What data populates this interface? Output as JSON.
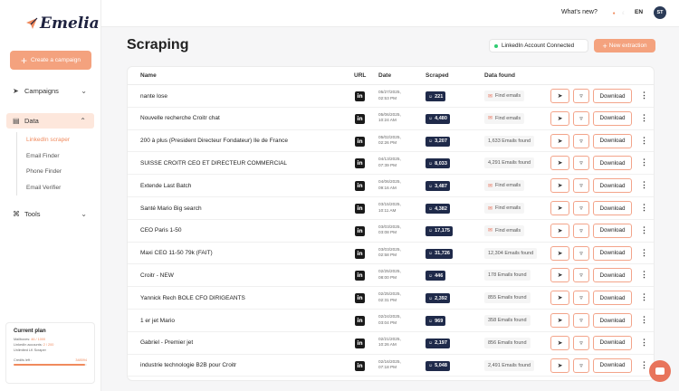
{
  "app": {
    "logo": "Emelia"
  },
  "sidebar": {
    "create_campaign": "Create a campaign",
    "campaigns": "Campaigns",
    "data": "Data",
    "data_sub": [
      "LinkedIn scraper",
      "Email Finder",
      "Phone Finder",
      "Email Verifier"
    ],
    "tools": "Tools",
    "plan": {
      "title": "Current plan",
      "mailboxes_label": "Mailboxes:",
      "mailboxes_value": "46 / 1000",
      "linkedin_label": "LinkedIn accounts:",
      "linkedin_value": "2 / 200",
      "scraper": "Unlimited LK Scraper",
      "credits_label": "Credits left :",
      "credits_value": "348594",
      "credits_fraction": 0.98
    }
  },
  "topbar": {
    "whats_new": "What's new?",
    "lang": "EN",
    "avatar": "ST"
  },
  "page": {
    "title": "Scraping",
    "linkedin_status": "LinkedIn Account Connected",
    "new_extraction": "New extraction"
  },
  "table": {
    "headers": {
      "name": "Name",
      "url": "URL",
      "date": "Date",
      "scraped": "Scraped",
      "found": "Data found"
    },
    "download_label": "Download",
    "find_emails_label": "Find emails",
    "rows": [
      {
        "name": "nante lose",
        "date1": "05/27/2025,",
        "date2": "02:53 PM",
        "scraped": "221",
        "found": "Find emails",
        "has_emails": false
      },
      {
        "name": "Nouvelle recherche Croitr chat",
        "date1": "05/06/2025,",
        "date2": "10:24 AM",
        "scraped": "4,480",
        "found": "Find emails",
        "has_emails": false
      },
      {
        "name": "200 à plus (President Directeur Fondateur) Ile de France",
        "date1": "05/02/2025,",
        "date2": "02:26 PM",
        "scraped": "3,207",
        "found": "1,633 Emails found",
        "has_emails": true
      },
      {
        "name": "SUISSE CROITR CEO ET DIRECTEUR COMMERCIAL",
        "date1": "04/13/2025,",
        "date2": "07:39 PM",
        "scraped": "8,033",
        "found": "4,291 Emails found",
        "has_emails": true
      },
      {
        "name": "Extende Last Batch",
        "date1": "04/06/2025,",
        "date2": "09:16 AM",
        "scraped": "3,487",
        "found": "Find emails",
        "has_emails": false
      },
      {
        "name": "Santé Mario Big search",
        "date1": "03/15/2025,",
        "date2": "10:11 AM",
        "scraped": "4,382",
        "found": "Find emails",
        "has_emails": false
      },
      {
        "name": "CEO Paris 1-50",
        "date1": "03/03/2025,",
        "date2": "03:08 PM",
        "scraped": "17,175",
        "found": "Find emails",
        "has_emails": false
      },
      {
        "name": "Maxi CEO 11-50 79k (FAIT)",
        "date1": "03/03/2025,",
        "date2": "02:58 PM",
        "scraped": "31,726",
        "found": "12,304 Emails found",
        "has_emails": true
      },
      {
        "name": "Croitr - NEW",
        "date1": "02/25/2025,",
        "date2": "08:00 PM",
        "scraped": "446",
        "found": "178 Emails found",
        "has_emails": true
      },
      {
        "name": "Yannick Rech BOLE CFO DIRIGEANTS",
        "date1": "02/25/2025,",
        "date2": "02:31 PM",
        "scraped": "2,392",
        "found": "855 Emails found",
        "has_emails": true
      },
      {
        "name": "1 er jet Mario",
        "date1": "02/24/2025,",
        "date2": "03:04 PM",
        "scraped": "969",
        "found": "358 Emails found",
        "has_emails": true
      },
      {
        "name": "Gabriel - Premier jet",
        "date1": "02/21/2025,",
        "date2": "10:26 AM",
        "scraped": "2,197",
        "found": "856 Emails found",
        "has_emails": true
      },
      {
        "name": "industrie technologie B2B pour Croitr",
        "date1": "02/16/2025,",
        "date2": "07:18 PM",
        "scraped": "5,048",
        "found": "2,491 Emails found",
        "has_emails": true
      }
    ]
  }
}
